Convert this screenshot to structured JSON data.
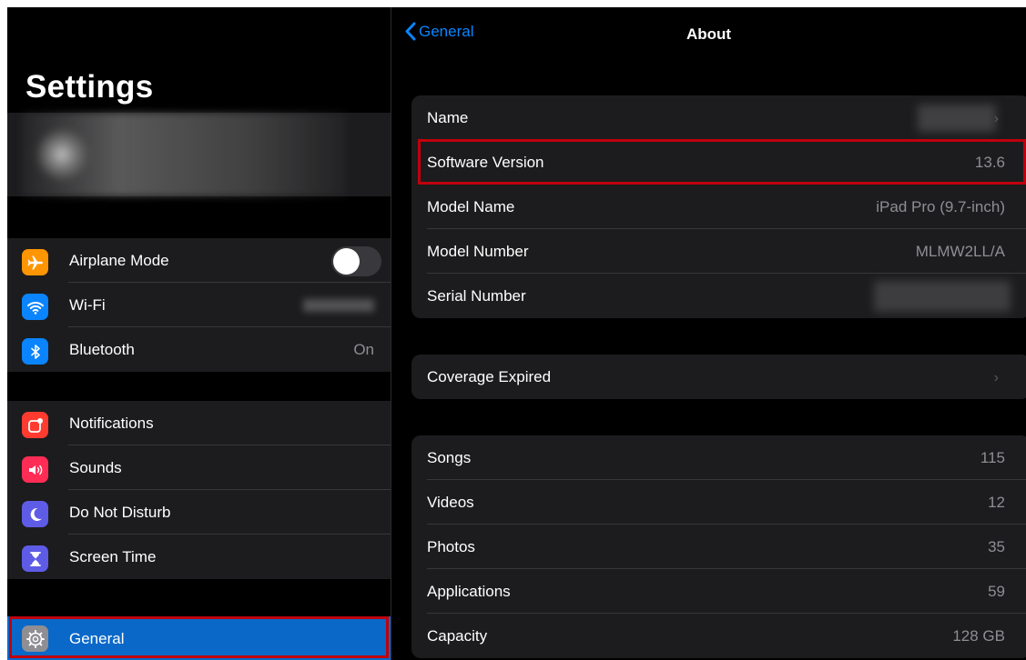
{
  "left": {
    "title": "Settings",
    "group1": [
      {
        "name": "airplane-mode",
        "label": "Airplane Mode",
        "icon": "airplane-icon",
        "color": "#ff9500",
        "toggle": false
      },
      {
        "name": "wifi",
        "label": "Wi-Fi",
        "icon": "wifi-icon",
        "color": "#0a84ff"
      },
      {
        "name": "bluetooth",
        "label": "Bluetooth",
        "icon": "bluetooth-icon",
        "color": "#0a84ff",
        "value": "On"
      }
    ],
    "group2": [
      {
        "name": "notifications",
        "label": "Notifications",
        "icon": "notifications-icon",
        "color": "#ff3b30"
      },
      {
        "name": "sounds",
        "label": "Sounds",
        "icon": "speaker-icon",
        "color": "#ff2d55"
      },
      {
        "name": "do-not-disturb",
        "label": "Do Not Disturb",
        "icon": "moon-icon",
        "color": "#5e5ce6"
      },
      {
        "name": "screen-time",
        "label": "Screen Time",
        "icon": "hourglass-icon",
        "color": "#5e5ce6"
      }
    ],
    "group3": [
      {
        "name": "general",
        "label": "General",
        "icon": "gear-icon",
        "color": "#8e8e93",
        "selected": true
      }
    ]
  },
  "right": {
    "back_label": "General",
    "title": "About",
    "group1": [
      {
        "label": "Name",
        "value": "",
        "chevron": true
      },
      {
        "label": "Software Version",
        "value": "13.6"
      },
      {
        "label": "Model Name",
        "value": "iPad Pro (9.7-inch)"
      },
      {
        "label": "Model Number",
        "value": "MLMW2LL/A"
      },
      {
        "label": "Serial Number",
        "value": ""
      }
    ],
    "group2": [
      {
        "label": "Coverage Expired",
        "chevron": true
      }
    ],
    "group3": [
      {
        "label": "Songs",
        "value": "115"
      },
      {
        "label": "Videos",
        "value": "12"
      },
      {
        "label": "Photos",
        "value": "35"
      },
      {
        "label": "Applications",
        "value": "59"
      },
      {
        "label": "Capacity",
        "value": "128 GB"
      }
    ]
  },
  "colors": {
    "accent": "#0a84ff",
    "selected_row": "#0a68c8",
    "highlight_box": "#c0000d"
  }
}
